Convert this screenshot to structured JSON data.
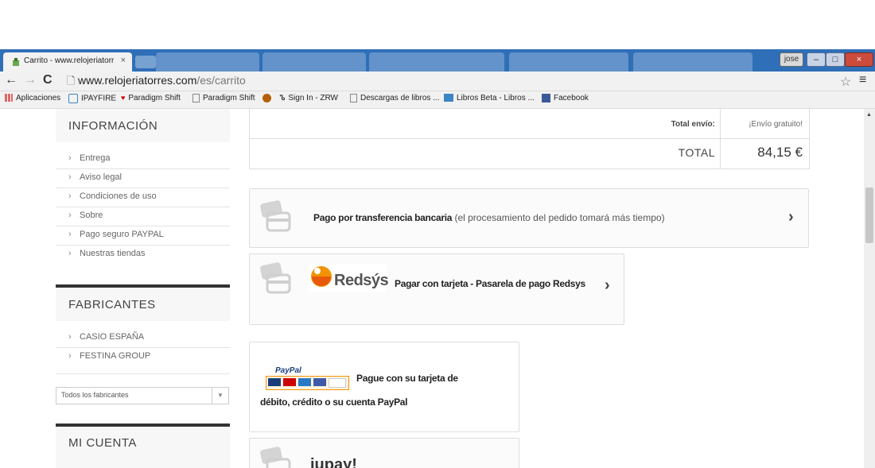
{
  "browser": {
    "tab_title": "Carrito - www.relojeriatorr",
    "tab_close": "×",
    "profile": "jose",
    "win_min": "–",
    "win_max": "□",
    "win_close": "×",
    "url_domain": "www.relojeriatorres.com",
    "url_path": "/es/carrito",
    "bookmarks": [
      {
        "label": "Aplicaciones"
      },
      {
        "label": "IPAYFIRE"
      },
      {
        "label": "Paradigm Shift"
      },
      {
        "label": "Paradigm Shift"
      },
      {
        "label": ""
      },
      {
        "label": "Sign In - ZRW"
      },
      {
        "label": "Descargas de libros ..."
      },
      {
        "label": "Libros Beta - Libros ..."
      },
      {
        "label": "Facebook"
      }
    ]
  },
  "sidebar": {
    "info_title": "INFORMACIÓN",
    "info_items": [
      "Entrega",
      "Aviso legal",
      "Condiciones de uso",
      "Sobre",
      "Pago seguro PAYPAL",
      "Nuestras tiendas"
    ],
    "manufacturers_title": "FABRICANTES",
    "manufacturer_items": [
      "CASIO ESPAÑA",
      "FESTINA GROUP"
    ],
    "manufacturer_select": "Todos los fabricantes",
    "account_title": "MI CUENTA"
  },
  "totals": {
    "shipping_label": "Total envío:",
    "shipping_value": "¡Envío gratuito!",
    "total_label": "TOTAL",
    "total_value": "84,15 €"
  },
  "payment": {
    "bank_bold": "Pago por transferencia bancaria",
    "bank_note": " (el procesamiento del pedido tomará más tiempo)",
    "redsys_logo": "Redsýs",
    "redsys_text": "Pagar con tarjeta - Pasarela de pago Redsys",
    "paypal_logo": "PayPal",
    "paypal_line1": "Pague con su tarjeta de",
    "paypal_line2": "débito, crédito o su cuenta PayPal",
    "next_partial": "iupay!"
  },
  "colors": {
    "tabbar": "#2f6fb8",
    "redsys_orange": "#f39200",
    "redsys_red": "#c8102e"
  }
}
